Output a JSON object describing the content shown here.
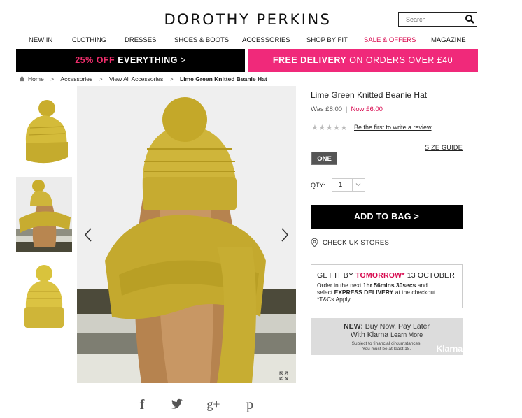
{
  "brand": {
    "logo": "DOROTHY PERKINS"
  },
  "search": {
    "placeholder": "Search"
  },
  "nav": [
    {
      "label": "NEW IN"
    },
    {
      "label": "CLOTHING"
    },
    {
      "label": "DRESSES"
    },
    {
      "label": "SHOES & BOOTS"
    },
    {
      "label": "ACCESSORIES"
    },
    {
      "label": "SHOP BY FIT"
    },
    {
      "label": "SALE & OFFERS"
    },
    {
      "label": "MAGAZINE"
    }
  ],
  "promos": {
    "left": {
      "highlight": "25% OFF",
      "bold": "EVERYTHING",
      "arrow": ">"
    },
    "right": {
      "bold": "FREE DELIVERY",
      "rest": "ON ORDERS OVER £40"
    }
  },
  "breadcrumb": {
    "items": [
      "Home",
      "Accessories",
      "View All Accessories",
      "Lime Green Knitted Beanie Hat"
    ],
    "separator": ">"
  },
  "product": {
    "title": "Lime Green Knitted Beanie Hat",
    "was_price": "Was £8.00",
    "divider": "|",
    "now_price": "Now £6.00",
    "stars": "★★★★★",
    "review_link": "Be the first to write a review",
    "size_guide": "SIZE GUIDE",
    "size": "ONE",
    "qty_label": "QTY:",
    "qty_value": "1",
    "add_to_bag": "ADD TO BAG >",
    "check_stores": "CHECK UK STORES"
  },
  "delivery": {
    "get_it": "GET IT BY",
    "tomorrow": "TOMORROW*",
    "date": "13 OCTOBER",
    "line2a": "Order in the next",
    "countdown": "1hr 56mins 30secs",
    "line2b": "and",
    "line3a": "select",
    "express": "EXPRESS DELIVERY",
    "line3b": "at the checkout.",
    "tc": "*T&Cs Apply"
  },
  "klarna": {
    "new": "NEW:",
    "line1": "Buy Now, Pay Later",
    "line2": "With Klarna",
    "learn": "Learn More",
    "small1": "Subject to financial circumstances.",
    "small2": "You must be at least 18.",
    "logo": "Klarna"
  },
  "social": {
    "facebook": "f",
    "twitter": "twitter-icon",
    "google": "g+",
    "pinterest": "p"
  },
  "colors": {
    "accent_pink": "#f0297a",
    "sale_red": "#d80a4f",
    "hat_mustard": "#c9b233"
  }
}
